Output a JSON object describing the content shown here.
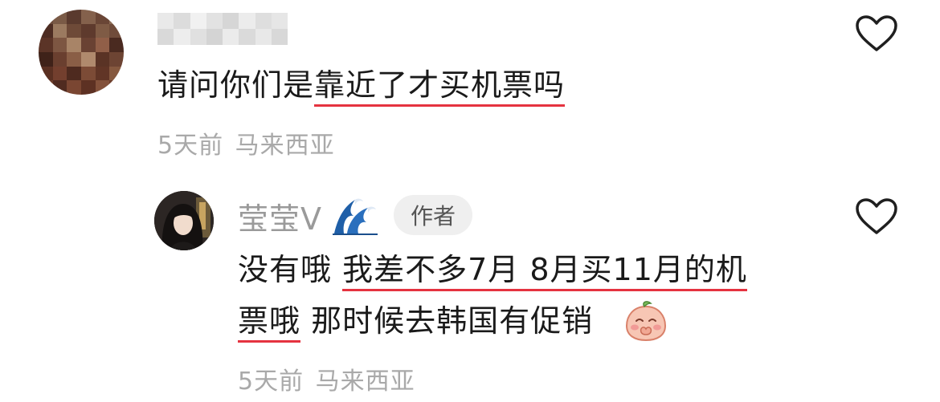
{
  "comment": {
    "user_name": "",
    "text_plain": "请问你们是",
    "text_highlight": "靠近了才买机票吗",
    "time": "5天前",
    "location": "马来西亚"
  },
  "reply": {
    "author_name": "莹莹V",
    "author_badge": "作者",
    "line1_plain": "没有哦 ",
    "line1_highlight": "我差不多7月 8月买11月的机",
    "line2_highlight": "票哦",
    "line2_plain": " 那时候去韩国有促销",
    "time": "5天前",
    "location": "马来西亚"
  },
  "icons": {
    "like": "heart-outline-icon",
    "name_emoji": "wave-emoji-icon",
    "sticker": "pleading-peach-emoji-icon"
  },
  "colors": {
    "highlight_underline": "#e53340",
    "meta_text": "#a9a9a9",
    "body_text": "#1a1a1a"
  }
}
